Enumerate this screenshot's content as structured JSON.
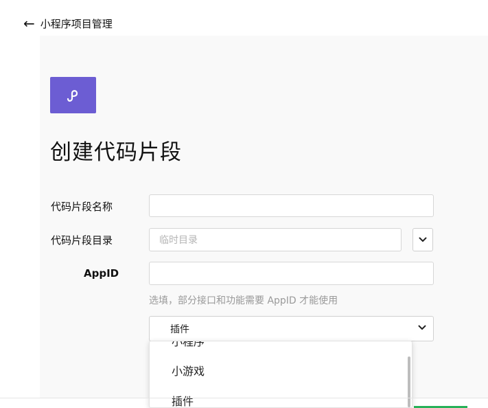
{
  "topbar": {
    "title": "小程序项目管理"
  },
  "page": {
    "title": "创建代码片段"
  },
  "form": {
    "name": {
      "label": "代码片段名称",
      "value": ""
    },
    "directory": {
      "label": "代码片段目录",
      "placeholder": "临时目录"
    },
    "appid": {
      "label": "AppID",
      "value": "",
      "hint": "选填，部分接口和功能需要 AppID 才能使用"
    },
    "type": {
      "selected": "插件",
      "options": [
        "小程序",
        "小游戏",
        "插件"
      ]
    }
  },
  "colors": {
    "logo": "#6c5dd3",
    "accent": "#27b158"
  }
}
